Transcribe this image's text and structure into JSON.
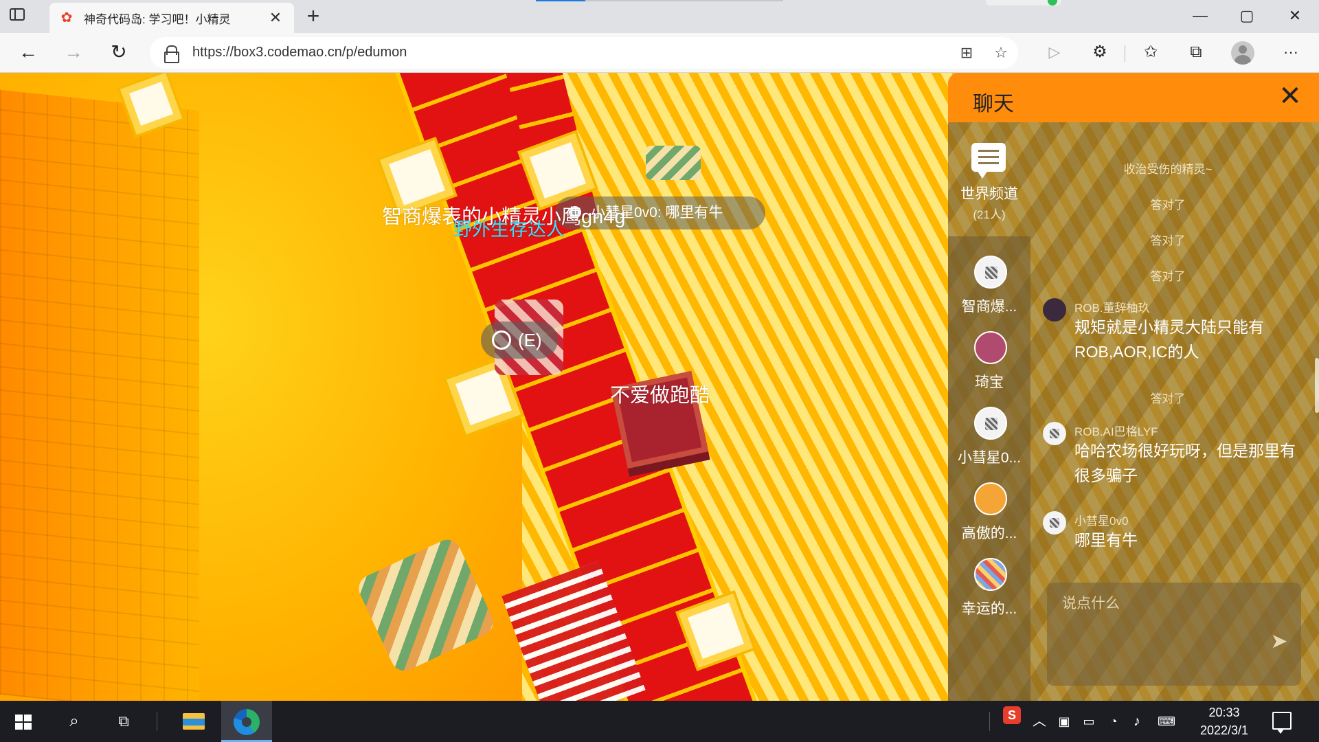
{
  "browser": {
    "tab": {
      "title": "神奇代码岛: 学习吧！小精灵",
      "favicon": "codemao-flower-icon"
    },
    "url": "https://box3.codemao.cn/p/edumon",
    "new_tab": "+",
    "window": {
      "minimize": "—",
      "maximize": "▢",
      "close": "✕"
    },
    "nav": {
      "back": "←",
      "forward": "→",
      "refresh": "↻",
      "more": "···"
    }
  },
  "game": {
    "bubble": "小彗星0v0: 哪里有牛",
    "nametags": {
      "player1": "智商爆表的小精灵小鹰gn4g",
      "player2": "野外生存达人",
      "player3": "不爱做跑酷"
    },
    "interact_label": "(E)"
  },
  "chat": {
    "title": "聊天",
    "close_label": "✕",
    "world_channel": {
      "name": "世界频道",
      "count": "(21人)"
    },
    "users": [
      {
        "name": "智商爆...",
        "avatar": "default"
      },
      {
        "name": "琦宝",
        "avatar": "purple"
      },
      {
        "name": "小彗星0...",
        "avatar": "default"
      },
      {
        "name": "高傲的...",
        "avatar": "orange"
      },
      {
        "name": "幸运的...",
        "avatar": "multi"
      }
    ],
    "system_messages": [
      "收治受伤的精灵~",
      "答对了",
      "答对了",
      "答对了",
      "答对了"
    ],
    "messages": [
      {
        "sender": "ROB.董辞柚玖",
        "text": "规矩就是小精灵大陆只能有ROB,AOR,IC的人"
      },
      {
        "sender": "ROB.AI巴格LYF",
        "text": "哈哈农场很好玩呀，但是那里有很多骗子"
      },
      {
        "sender": "小彗星0v0",
        "text": "哪里有牛"
      }
    ],
    "input_placeholder": "说点什么",
    "send_label": "➤"
  },
  "taskbar": {
    "ime_label": "S",
    "time": "20:33",
    "date": "2022/3/1"
  },
  "colors": {
    "chat_header": "#ff8c0b",
    "carpet_red": "#e31212",
    "floor_yellow": "#ffb700",
    "name_cyan": "#2fe6ff"
  }
}
